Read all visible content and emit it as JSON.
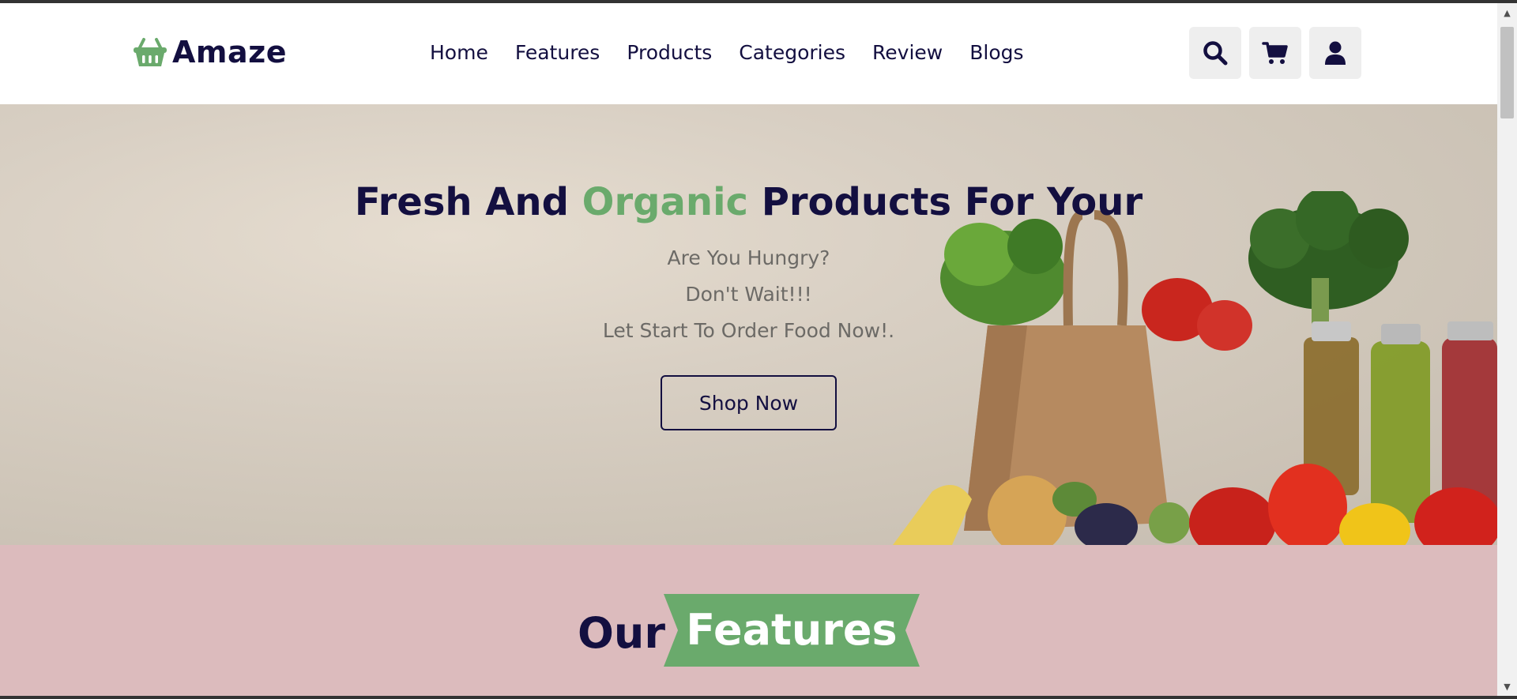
{
  "brand": {
    "name": "Amaze",
    "icon": "basket-icon",
    "accent": "#6aaa6c"
  },
  "nav": {
    "items": [
      "Home",
      "Features",
      "Products",
      "Categories",
      "Review",
      "Blogs"
    ]
  },
  "header_icons": [
    "search-icon",
    "cart-icon",
    "user-icon"
  ],
  "hero": {
    "title_part1": "Fresh And ",
    "title_accent": "Organic",
    "title_part2": " Products For Your",
    "line1": "Are You Hungry?",
    "line2": "Don't Wait!!!",
    "line3": "Let Start To Order Food Now!.",
    "button": "Shop Now"
  },
  "features": {
    "heading_prefix": "Our",
    "heading_label": "Features",
    "background": "#dcbbbd",
    "ribbon_color": "#6aaa6c"
  },
  "colors": {
    "primary": "#130f40",
    "accent": "#6aaa6c"
  }
}
